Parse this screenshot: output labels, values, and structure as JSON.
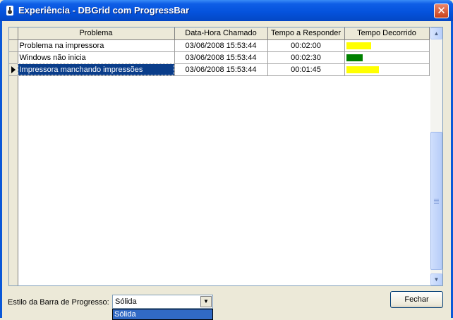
{
  "window": {
    "title": "Experiência - DBGrid com ProgressBar",
    "close_glyph": "✕"
  },
  "grid": {
    "columns": [
      "Problema",
      "Data-Hora Chamado",
      "Tempo a Responder",
      "Tempo Decorrido"
    ],
    "rows": [
      {
        "problema": "Problema na impressora",
        "data_hora": "03/06/2008 15:53:44",
        "tempo_responder": "00:02:00",
        "progress_fraction": 0.3,
        "progress_color": "#ffff00"
      },
      {
        "problema": "Windows não inicia",
        "data_hora": "03/06/2008 15:53:44",
        "tempo_responder": "00:02:30",
        "progress_fraction": 0.2,
        "progress_color": "#008000"
      },
      {
        "problema": "Impressora manchando impressões",
        "data_hora": "03/06/2008 15:53:44",
        "tempo_responder": "00:01:45",
        "progress_fraction": 0.4,
        "progress_color": "#ffff00"
      }
    ],
    "selected_row": 2,
    "scroll_up": "▲",
    "scroll_down": "▼"
  },
  "footer": {
    "style_label": "Estilo da Barra de Progresso:",
    "combo_value": "Sólida",
    "combo_arrow": "▼",
    "dropdown_options": [
      "Sólida"
    ],
    "close_button": "Fechar"
  },
  "colors": {
    "titlebar": "#0553dd",
    "selection": "#0a3d8a",
    "progress_yellow": "#ffff00",
    "progress_green": "#008000"
  }
}
